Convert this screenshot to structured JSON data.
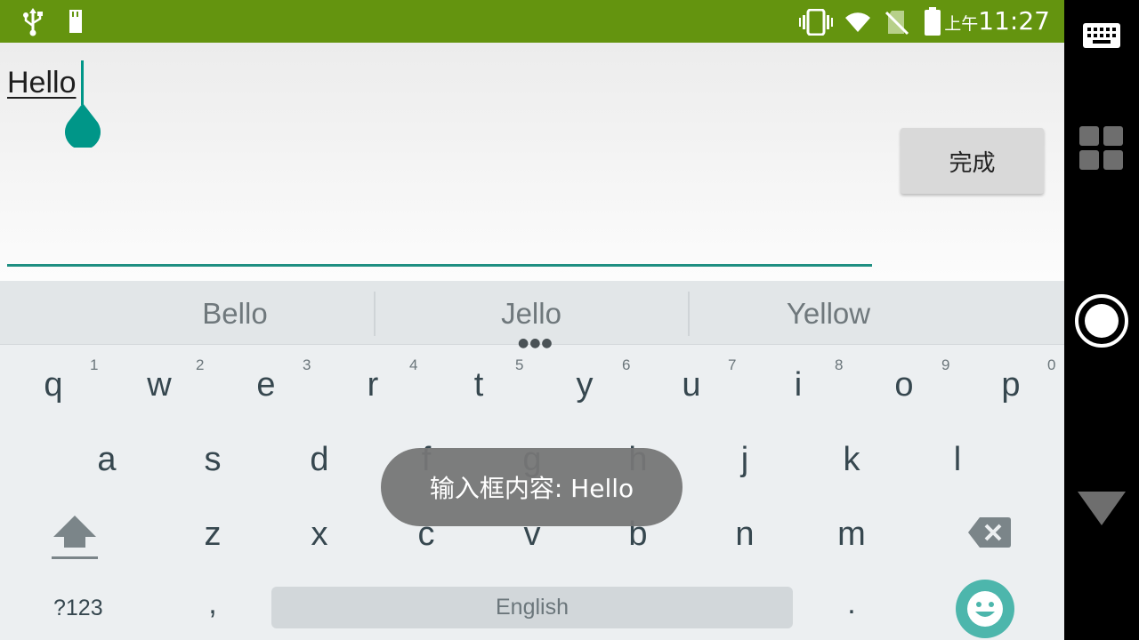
{
  "status_bar": {
    "time_ampm": "上午",
    "time": "11:27",
    "color": "#64940f",
    "icons": [
      "usb-icon",
      "sd-card-icon",
      "vibrate-icon",
      "wifi-icon",
      "no-sim-icon",
      "battery-icon"
    ]
  },
  "editor": {
    "input_value": "Hello",
    "done_label": "完成",
    "accent_color": "#009688"
  },
  "keyboard": {
    "suggestions": [
      "Bello",
      "Jello",
      "Yellow"
    ],
    "row1": [
      {
        "key": "q",
        "hint": "1"
      },
      {
        "key": "w",
        "hint": "2"
      },
      {
        "key": "e",
        "hint": "3"
      },
      {
        "key": "r",
        "hint": "4"
      },
      {
        "key": "t",
        "hint": "5"
      },
      {
        "key": "y",
        "hint": "6"
      },
      {
        "key": "u",
        "hint": "7"
      },
      {
        "key": "i",
        "hint": "8"
      },
      {
        "key": "o",
        "hint": "9"
      },
      {
        "key": "p",
        "hint": "0"
      }
    ],
    "row2": [
      "a",
      "s",
      "d",
      "f",
      "g",
      "h",
      "j",
      "k",
      "l"
    ],
    "row3": [
      "z",
      "x",
      "c",
      "v",
      "b",
      "n",
      "m"
    ],
    "symbols_label": "?123",
    "comma": ",",
    "space_label": "English",
    "period": "."
  },
  "toast": {
    "text": "输入框内容: Hello"
  },
  "nav_bar": {
    "icons": [
      "keyboard-icon",
      "apps-icon",
      "home-icon",
      "back-icon"
    ]
  }
}
